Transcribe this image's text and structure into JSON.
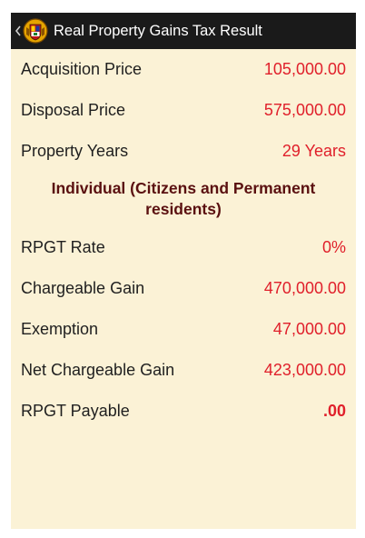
{
  "actionbar": {
    "title": "Real Property Gains Tax Result",
    "back_icon": "chevron-left-icon",
    "logo_icon": "app-crest-logo"
  },
  "results": {
    "acquisition": {
      "label": "Acquisition Price",
      "value": "105,000.00"
    },
    "disposal": {
      "label": "Disposal Price",
      "value": "575,000.00"
    },
    "years": {
      "label": "Property Years",
      "value": "29 Years"
    }
  },
  "section": {
    "heading": "Individual (Citizens and Permanent residents)"
  },
  "tax": {
    "rate": {
      "label": "RPGT Rate",
      "value": "0%"
    },
    "chargeable_gain": {
      "label": "Chargeable Gain",
      "value": "470,000.00"
    },
    "exemption": {
      "label": "Exemption",
      "value": "47,000.00"
    },
    "net_chargeable_gain": {
      "label": "Net Chargeable Gain",
      "value": "423,000.00"
    },
    "payable": {
      "label": "RPGT Payable",
      "value": ".00"
    }
  },
  "colors": {
    "background": "#fbf2d6",
    "actionbar": "#1a1a1a",
    "value_red": "#e0202b",
    "heading_maroon": "#5a1010"
  }
}
